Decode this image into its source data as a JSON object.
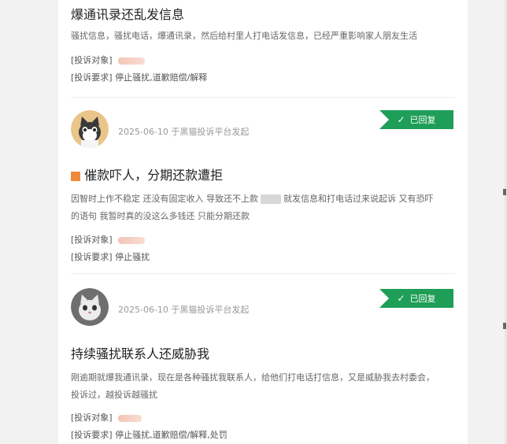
{
  "items": [
    {
      "title": "爆通讯录还乱发信息",
      "desc": "骚扰信息，骚扰电话，爆通讯录，然后给村里人打电话发信息，已经严重影响家人朋友生活",
      "target_label": "[投诉对象]",
      "request_label": "[投诉要求]",
      "request": "停止骚扰,道歉赔偿/解释"
    },
    {
      "date": "2025-06-10 于黑猫投诉平台发起",
      "status": "已回复",
      "title_tail": "催款吓人，分期还款遭拒",
      "desc_part1": "因智时上作不稳定 还没有固定收入 导致还不上款",
      "desc_part2": "就发信息和打电话过来说起诉 又有恐吓的语句 我暂时真的没这么多钱还 只能分期还款",
      "target_label": "[投诉对象]",
      "request_label": "[投诉要求]",
      "request": "停止骚扰"
    },
    {
      "date": "2025-06-10 于黑猫投诉平台发起",
      "status": "已回复",
      "title": "持续骚扰联系人还威胁我",
      "desc": "刚逾期就爆我通讯录，现在是各种骚扰我联系人，给他们打电话打信息，又是威胁我去村委会，投诉过，越投诉越骚扰",
      "target_label": "[投诉对象]",
      "request_label": "[投诉要求]",
      "request": "停止骚扰,道歉赔偿/解释,处罚"
    }
  ],
  "colors": {
    "accent": "#1e9e57"
  },
  "icons": {
    "status": "check-icon"
  }
}
